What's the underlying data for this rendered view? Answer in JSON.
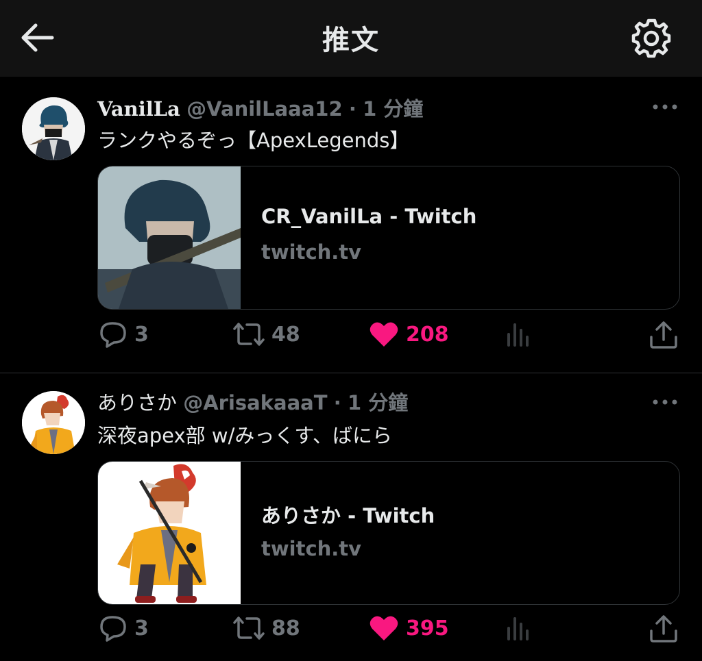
{
  "header": {
    "title": "推文",
    "back_icon": "arrow-left-icon",
    "settings_icon": "gear-icon"
  },
  "colors": {
    "accent_like": "#f91880",
    "muted": "#71767b",
    "background": "#000000",
    "header_bg": "#121212"
  },
  "tweets": [
    {
      "display_name": "VanilLa",
      "handle": "@VanilLaaa12",
      "dot": "·",
      "time": "1 分鐘",
      "text": "ランクやるぞっ【ApexLegends】",
      "card": {
        "title": "CR_VanilLa - Twitch",
        "domain": "twitch.tv"
      },
      "actions": {
        "replies": "3",
        "retweets": "48",
        "likes": "208",
        "liked": true
      }
    },
    {
      "display_name": "ありさか",
      "handle": "@ArisakaaaT",
      "dot": "·",
      "time": "1 分鐘",
      "text": "深夜apex部 w/みっくす、ばにら",
      "card": {
        "title": "ありさか - Twitch",
        "domain": "twitch.tv"
      },
      "actions": {
        "replies": "3",
        "retweets": "88",
        "likes": "395",
        "liked": true
      }
    }
  ]
}
